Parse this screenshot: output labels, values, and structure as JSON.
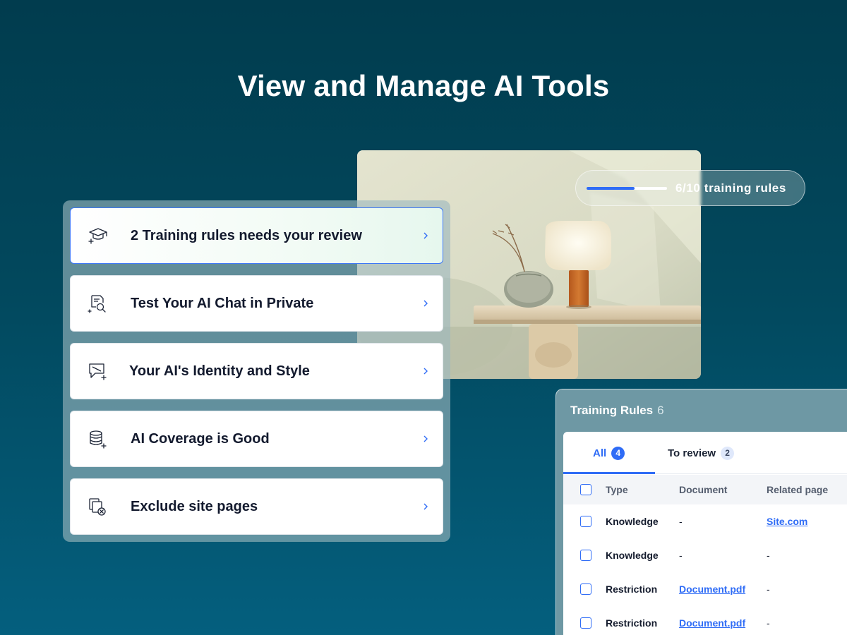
{
  "page": {
    "title": "View and Manage AI Tools"
  },
  "progress": {
    "label": "6/10 training rules",
    "value": 6,
    "max": 10
  },
  "menu": {
    "items": [
      {
        "label": "2 Training rules needs your review",
        "icon": "graduation-cap-sparkle-icon",
        "highlighted": true
      },
      {
        "label": "Test Your AI Chat in Private",
        "icon": "document-search-icon",
        "highlighted": false
      },
      {
        "label": "Your AI's Identity and Style",
        "icon": "chat-identity-icon",
        "highlighted": false
      },
      {
        "label": "AI Coverage is Good",
        "icon": "database-sparkle-icon",
        "highlighted": false
      },
      {
        "label": "Exclude site pages",
        "icon": "pages-exclude-icon",
        "highlighted": false
      }
    ]
  },
  "rules": {
    "title": "Training Rules",
    "count": "6",
    "tabs": [
      {
        "label": "All",
        "badge": "4",
        "active": true
      },
      {
        "label": "To review",
        "badge": "2",
        "active": false
      }
    ],
    "columns": [
      "Type",
      "Document",
      "Related page"
    ],
    "rows": [
      {
        "type": "Knowledge",
        "document": "-",
        "related_page": "Site.com",
        "doc_link": false,
        "page_link": true
      },
      {
        "type": "Knowledge",
        "document": "-",
        "related_page": "-",
        "doc_link": false,
        "page_link": false
      },
      {
        "type": "Restriction",
        "document": "Document.pdf",
        "related_page": "-",
        "doc_link": true,
        "page_link": false
      },
      {
        "type": "Restriction",
        "document": "Document.pdf",
        "related_page": "-",
        "doc_link": true,
        "page_link": false
      }
    ]
  },
  "colors": {
    "accent": "#2f6cf6",
    "background_top": "#013c4e",
    "background_bottom": "#045f7e"
  }
}
